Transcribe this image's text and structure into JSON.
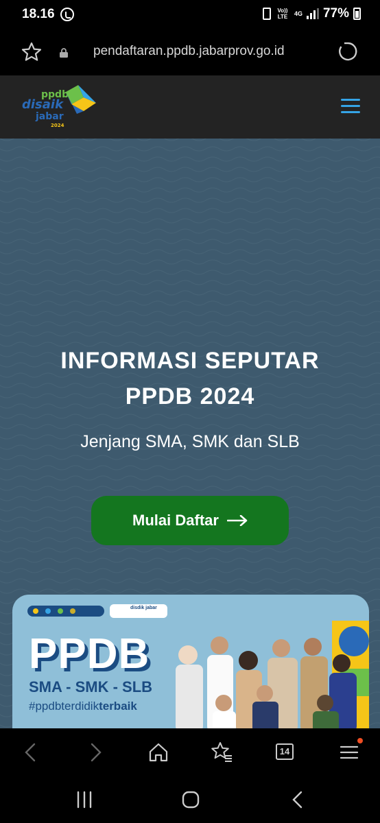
{
  "status_bar": {
    "time": "18.16",
    "volte_label": "Vo)) LTE",
    "network_label": "4G",
    "battery": "77%"
  },
  "browser": {
    "url": "pendaftaran.ppdb.jabarprov.go.id",
    "tabs_count": "14"
  },
  "site": {
    "logo_text": [
      "ppdb",
      "disaik",
      "jabar",
      "2024"
    ],
    "colors": {
      "header_bg": "#232323",
      "hero_bg": "#3e5a6e",
      "cta_bg": "#14761f",
      "menu_accent": "#35a4e6"
    }
  },
  "hero": {
    "title_line1": "INFORMASI SEPUTAR",
    "title_line2": "PPDB 2024",
    "subtitle": "Jenjang SMA, SMK dan SLB",
    "cta_label": "Mulai Daftar"
  },
  "banner": {
    "logos_text": "disdik jabar",
    "heading": "PPDB",
    "levels": "SMA - SMK - SLB",
    "hashtag_regular": "#ppdbterdidik",
    "hashtag_bold": "terbaik"
  }
}
